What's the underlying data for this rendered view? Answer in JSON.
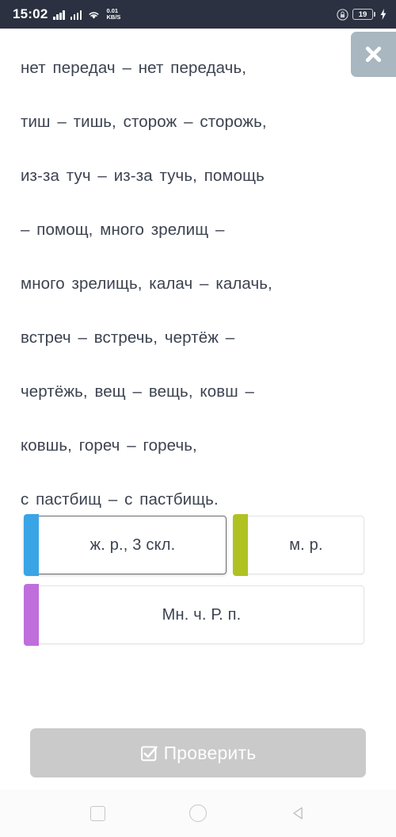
{
  "status_bar": {
    "clock": "15:02",
    "network_speed_value": "0.01",
    "network_speed_unit": "KB/S",
    "battery_level": "19",
    "icons": [
      "signal-bars-icon",
      "signal-bars-icon",
      "wifi-icon",
      "lock-icon",
      "battery-icon",
      "charging-bolt-icon"
    ],
    "background_color": "#2b3140"
  },
  "close_button": {
    "icon": "close-icon",
    "background_color": "#a8b7c0"
  },
  "task": {
    "lines": [
      "нет  передач  –  нет  передачь,",
      "тиш  –  тишь,  сторож  –  сторожь,",
      "из-за  туч  –  из-за  тучь,  помощь",
      "–  помощ,  много  зрелищ  –",
      "много  зрелищь,  калач  –  калачь,",
      "встреч  –  встречь,  чертёж  –",
      "чертёжь,  вещ  –  вещь,  ковш  –",
      "ковшь,  гореч  –  горечь,",
      "с  пастбищ  –  с  пастбищь."
    ],
    "text_color": "#3c4350"
  },
  "answers": {
    "cards": [
      {
        "label": "ж. р., 3 скл.",
        "stripe_color": "#39a5e6",
        "selected": true
      },
      {
        "label": "м. р.",
        "stripe_color": "#b0c222",
        "selected": false
      },
      {
        "label": "Мн. ч. Р. п.",
        "stripe_color": "#c06edc",
        "selected": false
      }
    ]
  },
  "check_button": {
    "label": "Проверить",
    "icon": "checkbox-checked-icon",
    "background_color": "#cacaca",
    "text_color": "#ffffff",
    "enabled": false
  },
  "nav_bar": {
    "buttons": [
      {
        "name": "recents",
        "icon": "square-icon"
      },
      {
        "name": "home",
        "icon": "circle-icon"
      },
      {
        "name": "back",
        "icon": "triangle-left-icon"
      }
    ]
  }
}
